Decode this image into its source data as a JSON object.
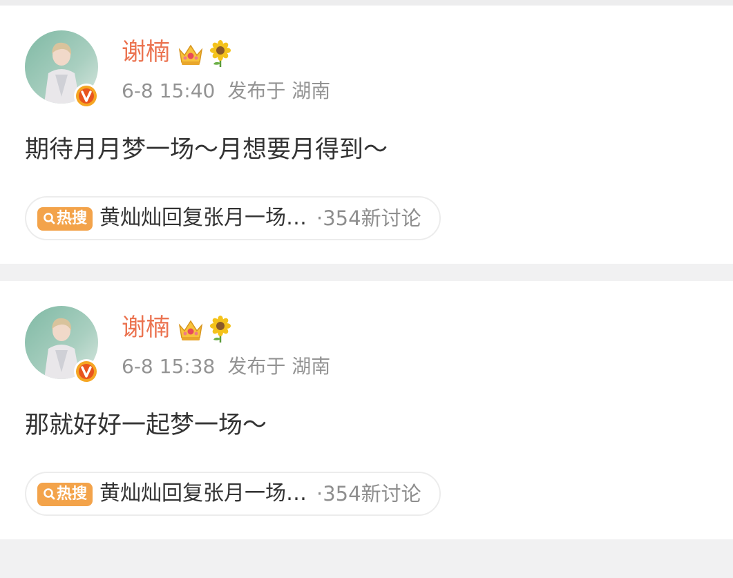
{
  "posts": [
    {
      "author": "谢楠",
      "time": "6-8 15:40",
      "location": "发布于 湖南",
      "content": "期待月月梦一场～月想要月得到～",
      "topic": {
        "tag": "热搜",
        "title": "黄灿灿回复张月一场…",
        "count": "·354新讨论"
      }
    },
    {
      "author": "谢楠",
      "time": "6-8 15:38",
      "location": "发布于 湖南",
      "content": "那就好好一起梦一场～",
      "topic": {
        "tag": "热搜",
        "title": "黄灿灿回复张月一场…",
        "count": "·354新讨论"
      }
    }
  ],
  "icons": {
    "verified": "verified-v-badge",
    "vip_crown": "crown-icon",
    "sunflower": "sunflower-icon",
    "search": "search-icon"
  },
  "colors": {
    "author_name": "#eb7350",
    "hot_tag": "#f3a34a",
    "verified_badge": "#f5a623",
    "meta_text": "#939393"
  }
}
